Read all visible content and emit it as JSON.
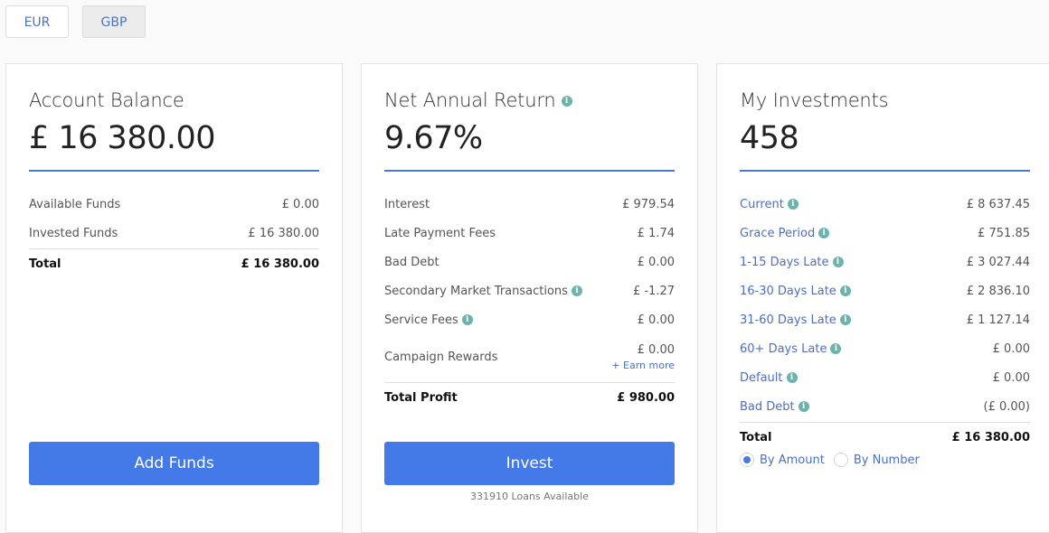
{
  "currency_tabs": [
    {
      "label": "EUR",
      "selected": false
    },
    {
      "label": "GBP",
      "selected": true
    }
  ],
  "account_balance": {
    "title": "Account Balance",
    "amount": "£ 16 380.00",
    "rows": [
      {
        "label": "Available Funds",
        "value": "£ 0.00"
      },
      {
        "label": "Invested Funds",
        "value": "£ 16 380.00"
      }
    ],
    "total": {
      "label": "Total",
      "value": "£ 16 380.00"
    },
    "button_label": "Add Funds"
  },
  "net_annual_return": {
    "title": "Net Annual Return",
    "info_icon": "info-icon",
    "amount": "9.67%",
    "rows": [
      {
        "label": "Interest",
        "value": "£ 979.54",
        "info": false
      },
      {
        "label": "Late Payment Fees",
        "value": "£ 1.74",
        "info": false
      },
      {
        "label": "Bad Debt",
        "value": "£ 0.00",
        "info": false
      },
      {
        "label": "Secondary Market Transactions",
        "value": "£ -1.27",
        "info": true
      },
      {
        "label": "Service Fees",
        "value": "£ 0.00",
        "info": true
      }
    ],
    "campaign": {
      "label": "Campaign Rewards",
      "value": "£ 0.00",
      "link": "+ Earn more"
    },
    "total": {
      "label": "Total Profit",
      "value": "£ 980.00"
    },
    "button_label": "Invest",
    "loans_available": "331910 Loans Available"
  },
  "my_investments": {
    "title": "My Investments",
    "amount": "458",
    "rows": [
      {
        "label": "Current",
        "value": "£ 8 637.45"
      },
      {
        "label": "Grace Period",
        "value": "£ 751.85"
      },
      {
        "label": "1-15 Days Late",
        "value": "£ 3 027.44"
      },
      {
        "label": "16-30 Days Late",
        "value": "£ 2 836.10"
      },
      {
        "label": "31-60 Days Late",
        "value": "£ 1 127.14"
      },
      {
        "label": "60+ Days Late",
        "value": "£ 0.00"
      },
      {
        "label": "Default",
        "value": "£ 0.00"
      },
      {
        "label": "Bad Debt",
        "value": "(£ 0.00)"
      }
    ],
    "total": {
      "label": "Total",
      "value": "£ 16 380.00"
    },
    "view_options": [
      {
        "label": "By Amount",
        "checked": true
      },
      {
        "label": "By Number",
        "checked": false
      }
    ]
  },
  "colors": {
    "accent": "#4479e8",
    "rule": "#4a78d0",
    "link": "#4a6fc4",
    "info": "#6db3ad"
  }
}
